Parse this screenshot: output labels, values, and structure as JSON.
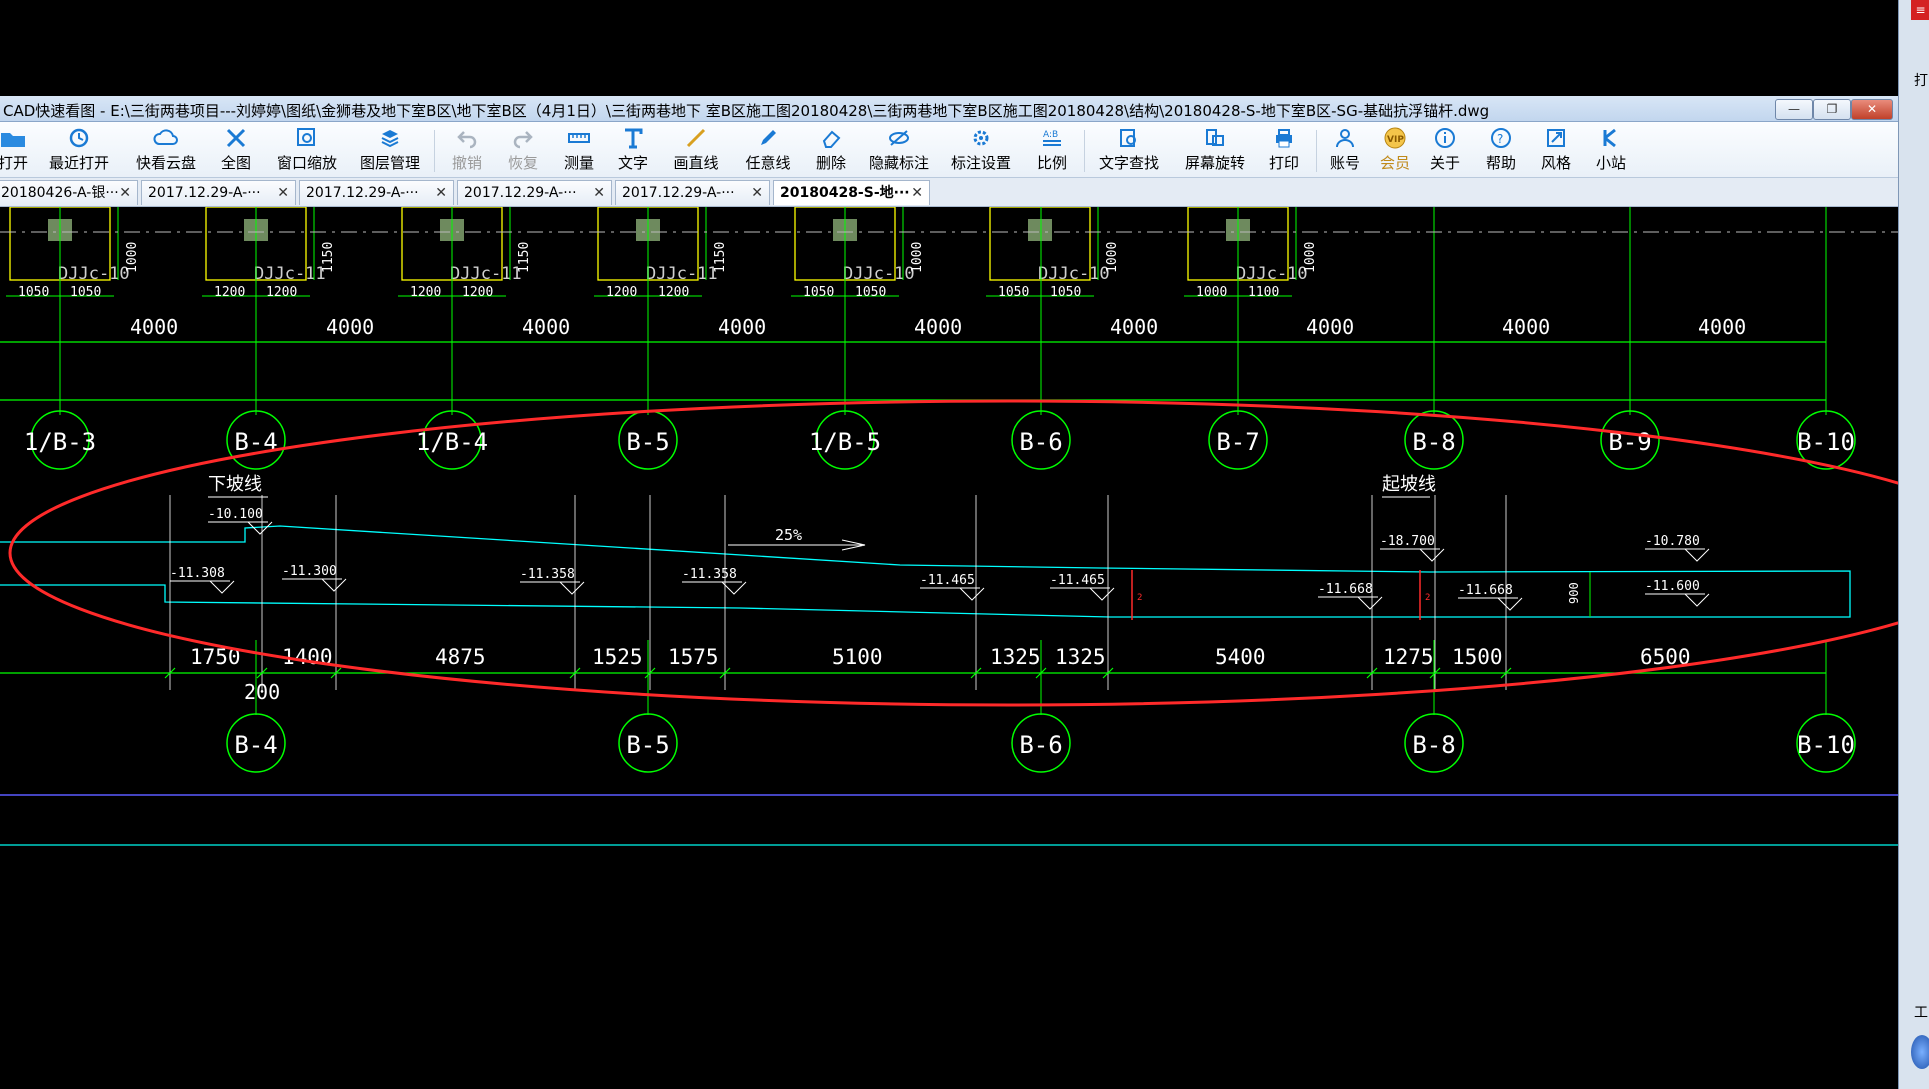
{
  "window": {
    "title": "CAD快速看图 - E:\\三街两巷项目---刘婷婷\\图纸\\金狮巷及地下室B区\\地下室B区（4月1日）\\三街两巷地下 室B区施工图20180428\\三街两巷地下室B区施工图20180428\\结构\\20180428-S-地下室B区-SG-基础抗浮锚杆.dwg",
    "minimize": "—",
    "restore": "❐",
    "close": "✕"
  },
  "toolbar": [
    {
      "label": "打开",
      "icon": "open-folder-icon"
    },
    {
      "label": "最近打开",
      "icon": "recent-clock-icon"
    },
    {
      "label": "快看云盘",
      "icon": "cloud-icon"
    },
    {
      "label": "全图",
      "icon": "fit-all-icon"
    },
    {
      "label": "窗口缩放",
      "icon": "zoom-window-icon"
    },
    {
      "label": "图层管理",
      "icon": "layers-icon"
    },
    {
      "label": "撤销",
      "icon": "undo-icon"
    },
    {
      "label": "恢复",
      "icon": "redo-icon"
    },
    {
      "label": "测量",
      "icon": "measure-icon"
    },
    {
      "label": "文字",
      "icon": "text-icon"
    },
    {
      "label": "画直线",
      "icon": "line-icon"
    },
    {
      "label": "任意线",
      "icon": "freehand-icon"
    },
    {
      "label": "删除",
      "icon": "eraser-icon"
    },
    {
      "label": "隐藏标注",
      "icon": "hide-eye-icon"
    },
    {
      "label": "标注设置",
      "icon": "settings-icon"
    },
    {
      "label": "比例",
      "icon": "scale-icon"
    },
    {
      "label": "文字查找",
      "icon": "text-search-icon"
    },
    {
      "label": "屏幕旋转",
      "icon": "rotate-icon"
    },
    {
      "label": "打印",
      "icon": "printer-icon"
    },
    {
      "label": "账号",
      "icon": "user-icon"
    },
    {
      "label": "会员",
      "icon": "vip-icon"
    },
    {
      "label": "关于",
      "icon": "info-icon"
    },
    {
      "label": "帮助",
      "icon": "help-icon"
    },
    {
      "label": "风格",
      "icon": "style-icon"
    },
    {
      "label": "小站",
      "icon": "station-icon"
    }
  ],
  "tabs": [
    {
      "label": "20180426-A-银···"
    },
    {
      "label": "2017.12.29-A-···"
    },
    {
      "label": "2017.12.29-A-···"
    },
    {
      "label": "2017.12.29-A-···"
    },
    {
      "label": "2017.12.29-A-···"
    },
    {
      "label": "20180428-S-地···"
    }
  ],
  "tab_close": "✕",
  "drawing": {
    "foundations": [
      {
        "name": "DJJc-10",
        "dims": [
          "1050",
          "1050"
        ],
        "h": "1000"
      },
      {
        "name": "DJJc-11",
        "dims": [
          "1200",
          "1200"
        ],
        "h": "1150"
      },
      {
        "name": "DJJc-11",
        "dims": [
          "1200",
          "1200"
        ],
        "h": "1150"
      },
      {
        "name": "DJJc-11",
        "dims": [
          "1200",
          "1200"
        ],
        "h": "1150"
      },
      {
        "name": "DJJc-10",
        "dims": [
          "1050",
          "1050"
        ],
        "h": "1000"
      },
      {
        "name": "DJJc-10",
        "dims": [
          "1050",
          "1050"
        ],
        "h": "1000"
      },
      {
        "name": "DJJc-10",
        "dims": [
          "1000",
          "1100"
        ],
        "h": "1000"
      }
    ],
    "spans": [
      "4000",
      "4000",
      "4000",
      "4000",
      "4000",
      "4000",
      "4000",
      "4000",
      "4000"
    ],
    "axes_top": [
      "1/B-3",
      "B-4",
      "1/B-4",
      "B-5",
      "1/B-5",
      "B-6",
      "B-7",
      "B-8",
      "B-9",
      "B-10"
    ],
    "axes_bottom": [
      "B-4",
      "B-5",
      "B-6",
      "B-8",
      "B-10"
    ],
    "slope_down_label": "下坡线",
    "slope_up_label": "起坡线",
    "slope_percent": "25%",
    "elevations": [
      "-10.100",
      "-11.308",
      "-11.300",
      "-11.358",
      "-11.358",
      "-11.465",
      "-11.465",
      "-18.700",
      "-11.668",
      "-11.668",
      "-10.780",
      "-11.600"
    ],
    "bottom_dims": [
      "1750",
      "1400",
      "4875",
      "1525",
      "1575",
      "5100",
      "1325",
      "1325",
      "5400",
      "1275",
      "1500",
      "6500"
    ],
    "dim_200": "200",
    "dim_900": "900",
    "colors": {
      "grid": "#00ff00",
      "slab": "#00ffff",
      "foundation": "#ffff00",
      "text": "#ffffff",
      "markup": "#ff2a2a"
    }
  },
  "right_panel": {
    "corner": "≡",
    "t1": "打",
    "t2": "工"
  }
}
